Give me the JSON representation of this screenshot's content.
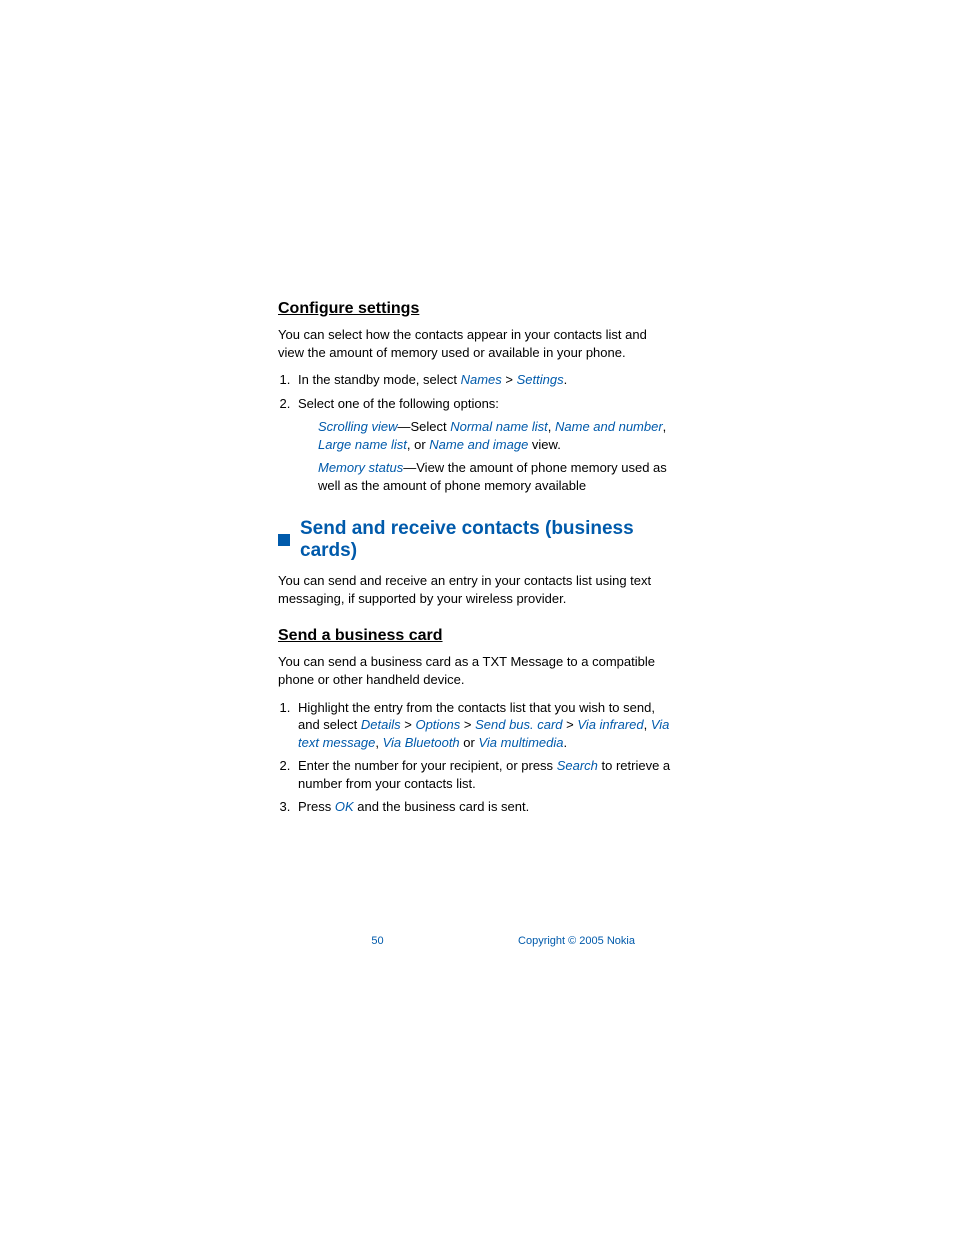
{
  "section1": {
    "heading": "Configure settings",
    "para": "You can select how the contacts appear in your contacts list and view the amount of memory used or available in your phone.",
    "step1_pre": "In the standby mode, select ",
    "step1_link1": "Names",
    "step1_sep": " > ",
    "step1_link2": "Settings",
    "step1_post": ".",
    "step2": "Select one of the following options:",
    "sub1_term": "Scrolling view",
    "sub1_sep": "—Select ",
    "sub1_opt1": "Normal name list",
    "sub1_c1": ", ",
    "sub1_opt2": "Name and number",
    "sub1_c2": ", ",
    "sub1_opt3": "Large name list",
    "sub1_c3": ", or ",
    "sub1_opt4": "Name and image",
    "sub1_post": " view.",
    "sub2_term": "Memory status",
    "sub2_post": "—View the amount of phone memory used as well as the amount of phone memory available"
  },
  "section2": {
    "heading": "Send and receive contacts (business cards)",
    "para": "You can send and receive an entry in your contacts list using text messaging, if supported by your wireless provider."
  },
  "section3": {
    "heading": "Send a business card",
    "para": "You can send a business card as a TXT Message to a compatible phone or other handheld device.",
    "step1_pre": "Highlight the entry from the contacts list that you wish to send, and select ",
    "s1_l1": "Details",
    "s1_s1": " > ",
    "s1_l2": "Options",
    "s1_s2": " > ",
    "s1_l3": "Send bus. card",
    "s1_s3": " > ",
    "s1_l4": "Via infrared",
    "s1_c1": ", ",
    "s1_l5": "Via text message",
    "s1_c2": ", ",
    "s1_l6": "Via Bluetooth",
    "s1_c3": " or ",
    "s1_l7": "Via multimedia",
    "s1_post": ".",
    "step2_pre": "Enter the number for your recipient, or press ",
    "step2_link": "Search",
    "step2_post": " to retrieve a number from your contacts list.",
    "step3_pre": "Press ",
    "step3_link": "OK",
    "step3_post": " and the business card is sent."
  },
  "footer": {
    "page": "50",
    "copyright": "Copyright © 2005 Nokia"
  }
}
